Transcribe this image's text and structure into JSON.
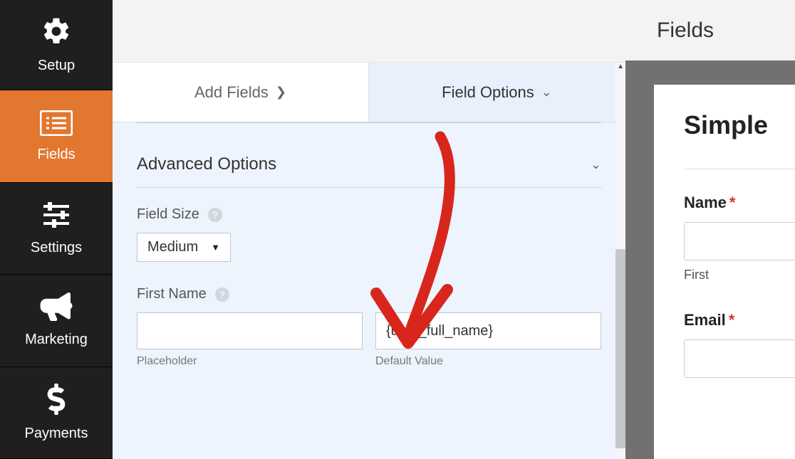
{
  "sidebar": {
    "items": [
      {
        "label": "Setup"
      },
      {
        "label": "Fields"
      },
      {
        "label": "Settings"
      },
      {
        "label": "Marketing"
      },
      {
        "label": "Payments"
      }
    ]
  },
  "tabs": {
    "add": "Add Fields",
    "options": "Field Options"
  },
  "panel": {
    "advanced_title": "Advanced Options",
    "field_size_label": "Field Size",
    "field_size_value": "Medium",
    "first_name_label": "First Name",
    "placeholder_sub": "Placeholder",
    "default_value_sub": "Default Value",
    "placeholder_value": "",
    "default_value_value": "{user_full_name}"
  },
  "right": {
    "header": "Fields",
    "form_title": "Simple",
    "name_label": "Name",
    "name_sub": "First",
    "email_label": "Email"
  }
}
